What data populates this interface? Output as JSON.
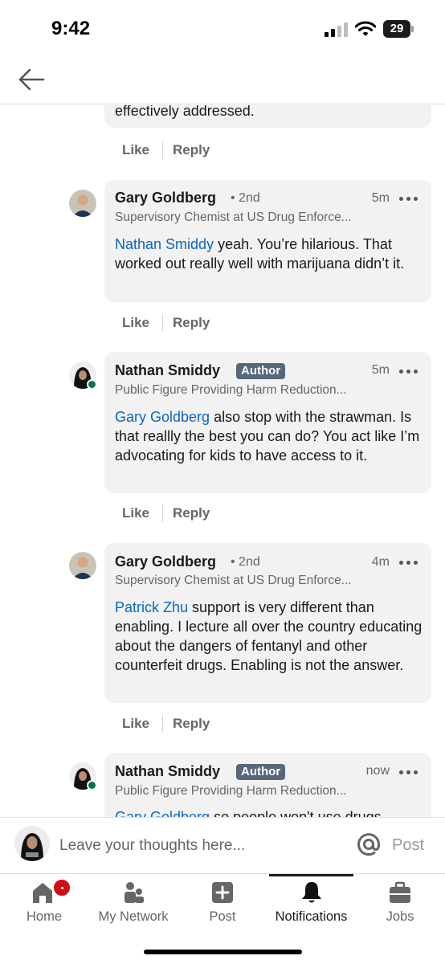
{
  "status_bar": {
    "time": "9:42",
    "battery": "29"
  },
  "header": {
    "back_icon": "arrow-left-icon"
  },
  "previous_comment": {
    "tail_text": "effectively addressed.",
    "like": "Like",
    "reply": "Reply"
  },
  "comments": [
    {
      "name": "Gary Goldberg",
      "degree": "• 2nd",
      "badge": "",
      "headline": "Supervisory Chemist at US Drug Enforce...",
      "time": "5m",
      "mention": "Nathan Smiddy",
      "text": " yeah.   You’re hilarious.  That worked out really well with marijuana didn’t it.",
      "like": "Like",
      "reply": "Reply"
    },
    {
      "name": "Nathan Smiddy",
      "degree": "",
      "badge": "Author",
      "headline": "Public Figure Providing Harm Reduction...",
      "time": "5m",
      "mention": "Gary Goldberg",
      "text": " also stop with the strawman. Is that reallly the best you can do? You act like I’m advocating for kids to have access to it.",
      "like": "Like",
      "reply": "Reply"
    },
    {
      "name": "Gary Goldberg",
      "degree": "• 2nd",
      "badge": "",
      "headline": "Supervisory Chemist at US Drug Enforce...",
      "time": "4m",
      "mention": "Patrick Zhu",
      "text": " support is very different than enabling.  I lecture all over the country educating about the dangers of fentanyl and other counterfeit drugs.  Enabling is not the answer.",
      "like": "Like",
      "reply": "Reply"
    },
    {
      "name": "Nathan Smiddy",
      "degree": "",
      "badge": "Author",
      "headline": "Public Figure Providing Harm Reduction...",
      "time": "now",
      "mention": "Gary Goldberg",
      "text": " so people won't use drugs",
      "like": "",
      "reply": ""
    }
  ],
  "compose": {
    "placeholder": "Leave your thoughts here...",
    "post": "Post"
  },
  "tabs": [
    {
      "label": "Home",
      "icon": "home-icon"
    },
    {
      "label": "My Network",
      "icon": "network-icon"
    },
    {
      "label": "Post",
      "icon": "plus-square-icon"
    },
    {
      "label": "Notifications",
      "icon": "bell-icon"
    },
    {
      "label": "Jobs",
      "icon": "briefcase-icon"
    }
  ],
  "colors": {
    "link": "#0a66c2",
    "badge": "#56687a",
    "online": "#057642",
    "notification": "#cc1016"
  }
}
